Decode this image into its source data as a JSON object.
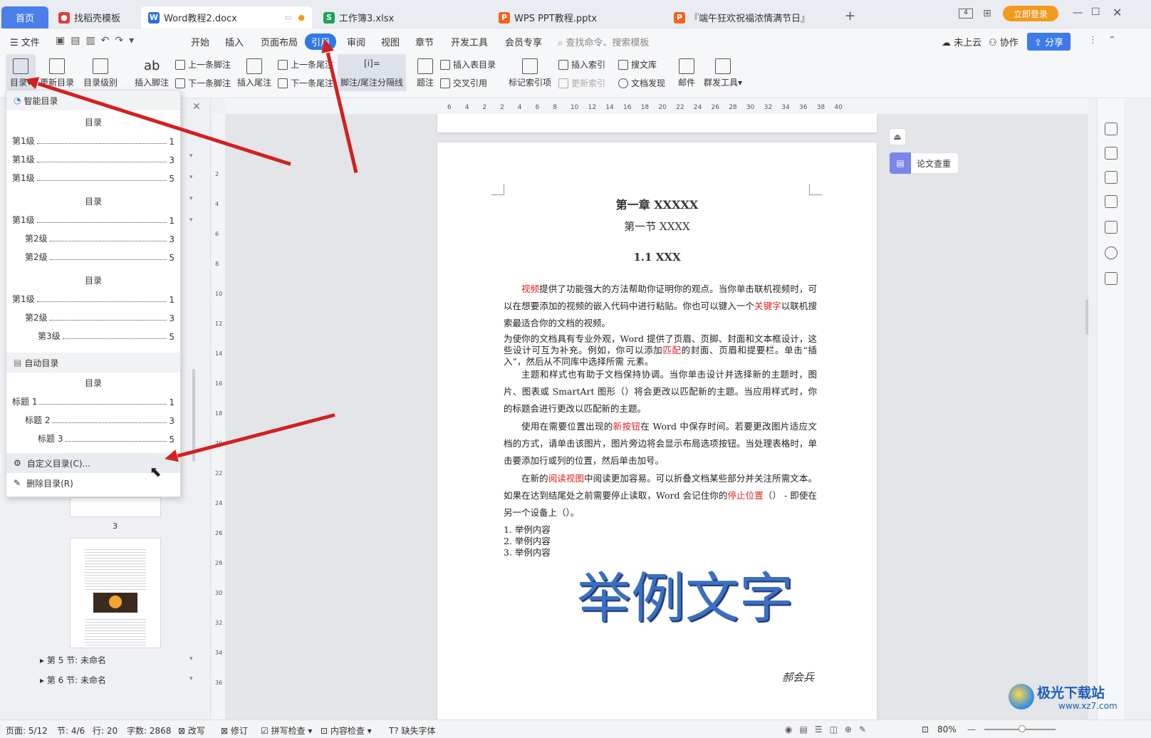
{
  "tabs": [
    {
      "label": "首页"
    },
    {
      "label": "找稻壳模板"
    },
    {
      "label": "Word教程2.docx"
    },
    {
      "label": "工作簿3.xlsx"
    },
    {
      "label": "WPS PPT教程.pptx"
    },
    {
      "label": "『端午狂欢祝福浓情满节日』"
    }
  ],
  "window": {
    "login_label": "立即登录",
    "new_tab": "+"
  },
  "menu": {
    "file": "文件",
    "items": [
      "开始",
      "插入",
      "页面布局",
      "引用",
      "审阅",
      "视图",
      "章节",
      "开发工具",
      "会员专享"
    ],
    "active": "引用",
    "search_placeholder": "查找命令、搜索模板",
    "cloud": "未上云",
    "collab": "协作",
    "share": "分享"
  },
  "ribbon": {
    "toc": "目录",
    "update_toc": "更新目录",
    "toc_level": "目录级别",
    "insert_footnote": "插入脚注",
    "prev_footnote": "上一条脚注",
    "next_footnote": "下一条脚注",
    "insert_endnote": "插入尾注",
    "prev_endnote": "上一条尾注",
    "next_endnote": "下一条尾注",
    "separator": "脚注/尾注分隔线",
    "caption": "题注",
    "insert_table_of_figures": "插入表目录",
    "cross_ref": "交叉引用",
    "mark_index": "标记索引项",
    "insert_index": "插入索引",
    "update_index": "更新索引",
    "search_lib": "搜文库",
    "doc_discover": "文档发现",
    "mail": "邮件",
    "batch_tools": "群发工具"
  },
  "dropdown": {
    "smart_header": "智能目录",
    "auto_header": "自动目录",
    "groups": [
      {
        "title": "目录",
        "lines": [
          {
            "text": "第1级",
            "page": "1",
            "indent": 0
          },
          {
            "text": "第1级",
            "page": "3",
            "indent": 0
          },
          {
            "text": "第1级",
            "page": "5",
            "indent": 0
          }
        ]
      },
      {
        "title": "目录",
        "lines": [
          {
            "text": "第1级",
            "page": "1",
            "indent": 0
          },
          {
            "text": "第2级",
            "page": "3",
            "indent": 1
          },
          {
            "text": "第2级",
            "page": "5",
            "indent": 1
          }
        ]
      },
      {
        "title": "目录",
        "lines": [
          {
            "text": "第1级",
            "page": "1",
            "indent": 0
          },
          {
            "text": "第2级",
            "page": "3",
            "indent": 1
          },
          {
            "text": "第3级",
            "page": "5",
            "indent": 2
          }
        ]
      }
    ],
    "auto_group": {
      "title": "目录",
      "lines": [
        {
          "text": "标题 1",
          "page": "1",
          "indent": 0
        },
        {
          "text": "标题 2",
          "page": "3",
          "indent": 1
        },
        {
          "text": "标题 3",
          "page": "5",
          "indent": 2
        }
      ]
    },
    "custom": "自定义目录(C)...",
    "delete": "删除目录(R)"
  },
  "nav": {
    "page_num": "3",
    "section5": "第 5 节: 未命名",
    "section6": "第 6 节: 未命名"
  },
  "ruler": {
    "ticks": [
      "6",
      "4",
      "2",
      "2",
      "4",
      "6",
      "8",
      "10",
      "12",
      "14",
      "16",
      "18",
      "20",
      "22",
      "24",
      "26",
      "28",
      "30",
      "32",
      "34",
      "36",
      "38",
      "40"
    ]
  },
  "vruler": {
    "ticks": [
      "2",
      "4",
      "6",
      "8",
      "10",
      "12",
      "14",
      "16",
      "18",
      "20",
      "22",
      "24",
      "26",
      "28",
      "30",
      "32",
      "34",
      "36"
    ]
  },
  "doc": {
    "chapter": "第一章  XXXXX",
    "section": "第一节  XXXX",
    "heading": "1.1 XXX",
    "p1a": "视频",
    "p1b": "提供了功能强大的方法帮助你证明你的观点。当你单击联机视频时，可以在想要添加的视频的嵌入代码中进行粘贴。你也可以键入一个",
    "p1c": "关键字",
    "p1d": "以联机搜索最适合你的文档的视频。",
    "p2a": "为使你的文档具有专业外观，Word 提供了页眉、页脚、封面和文本框设计，这些设计可互为补充。例如，你可以添加",
    "p2b": "匹配",
    "p2c": "的封面、页眉和提要栏。单击“插入”，然后从不同库中选择所需 元素。",
    "p3": "主题和样式也有助于文档保持协调。当你单击设计并选择新的主题时，图片、图表或 SmartArt 图形（）将会更改以匹配新的主题。当应用样式时，你的标题会进行更改以匹配新的主题。",
    "p4a": "使用在需要位置出现的",
    "p4b": "新按钮",
    "p4c": "在 Word 中保存时间。若要更改图片适应文档的方式，请单击该图片，图片旁边将会显示布局选项按钮。当处理表格时，单击要添加行或列的位置，然后单击加号。",
    "p5a": "在新的",
    "p5b": "阅读视图",
    "p5c": "中阅读更加容易。可以折叠文档某些部分并关注所需文本。如果在达到结尾处之前需要停止读取，Word 会记住你的",
    "p5d": "停止位置",
    "p5e": "（） - 即使在另一个设备上（）。",
    "list": [
      "1. 举例内容",
      "2. 举例内容",
      "3. 举例内容"
    ],
    "big_text": "举例文字",
    "signature": "郝会兵"
  },
  "side_panel": {
    "paper_check": "论文查重"
  },
  "status": {
    "page": "页面: 5/12",
    "section": "节: 4/6",
    "row": "行: 20",
    "words": "字数: 2868",
    "revise": "改写",
    "track": "修订",
    "spell": "拼写检查",
    "content": "内容检查",
    "missing_font": "缺失字体",
    "zoom": "80%"
  },
  "watermark": {
    "site": "极光下载站",
    "url": "www.xz7.com"
  },
  "colors": {
    "accent": "#3d7be8",
    "active_menu": "#2f79e6",
    "arrow": "#d32020",
    "login": "#f39a1e"
  }
}
